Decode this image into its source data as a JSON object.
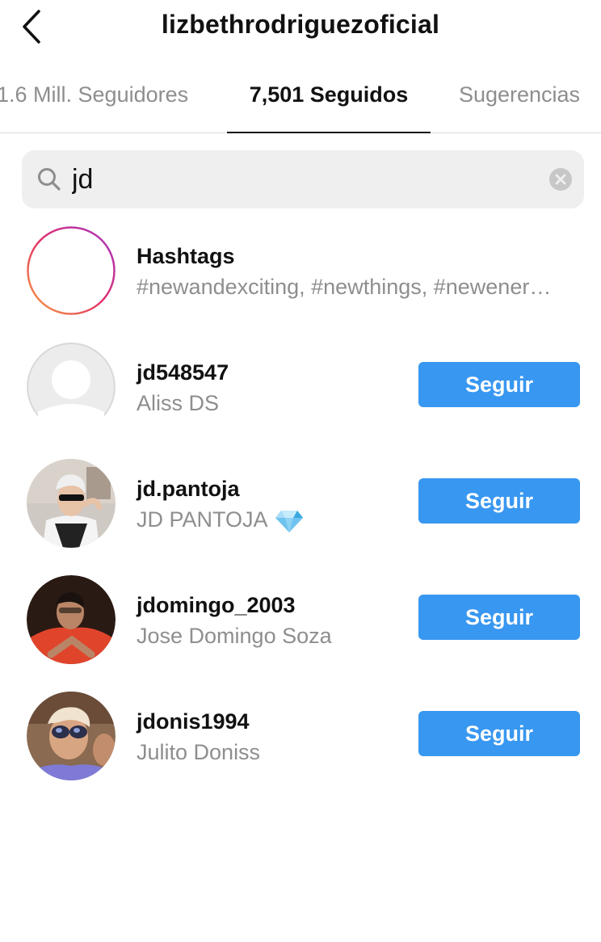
{
  "header": {
    "title": "lizbethrodriguezoficial",
    "back_icon": "chevron-left-icon"
  },
  "tabs": [
    {
      "label": "1.6 Mill. Seguidores",
      "active": false
    },
    {
      "label": "7,501 Seguidos",
      "active": true
    },
    {
      "label": "Sugerencias",
      "active": false
    }
  ],
  "search": {
    "value": "jd",
    "icon": "search-icon",
    "clear_icon": "clear-icon"
  },
  "hashtags": {
    "title": "Hashtags",
    "subtitle": "#newandexciting, #newthings, #newener…",
    "icon": "hashtag-icon"
  },
  "results": [
    {
      "username": "jd548547",
      "fullname": "Aliss DS",
      "button": "Seguir",
      "avatar": "default-avatar"
    },
    {
      "username": "jd.pantoja",
      "fullname": "JD PANTOJA",
      "button": "Seguir",
      "avatar": "photo",
      "emoji": "gem-icon"
    },
    {
      "username": "jdomingo_2003",
      "fullname": "Jose Domingo Soza",
      "button": "Seguir",
      "avatar": "photo"
    },
    {
      "username": "jdonis1994",
      "fullname": "Julito Doniss",
      "button": "Seguir",
      "avatar": "photo"
    }
  ],
  "colors": {
    "follow_button": "#3897f0",
    "secondary_text": "#8e8e8e",
    "search_bg": "#efefef"
  }
}
